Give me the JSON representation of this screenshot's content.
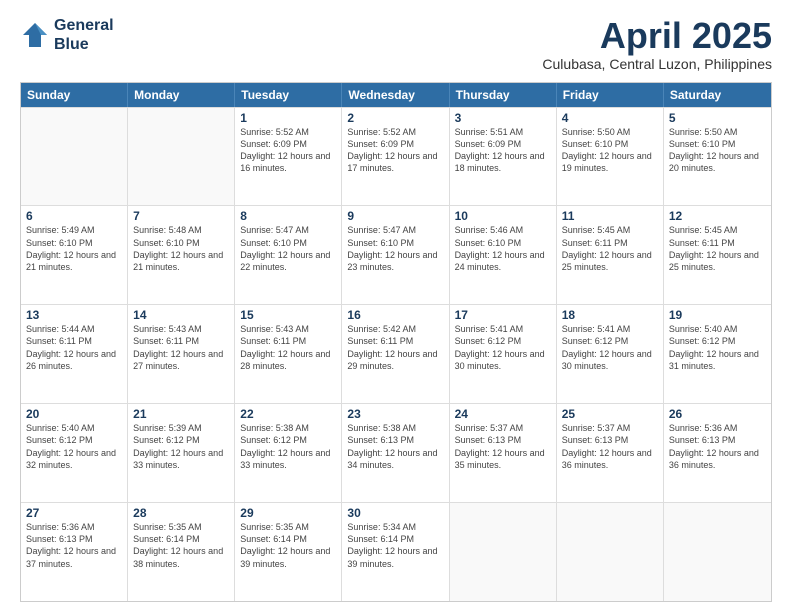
{
  "logo": {
    "line1": "General",
    "line2": "Blue"
  },
  "title": "April 2025",
  "subtitle": "Culubasa, Central Luzon, Philippines",
  "header_days": [
    "Sunday",
    "Monday",
    "Tuesday",
    "Wednesday",
    "Thursday",
    "Friday",
    "Saturday"
  ],
  "weeks": [
    [
      {
        "day": "",
        "info": ""
      },
      {
        "day": "",
        "info": ""
      },
      {
        "day": "1",
        "info": "Sunrise: 5:52 AM\nSunset: 6:09 PM\nDaylight: 12 hours\nand 16 minutes."
      },
      {
        "day": "2",
        "info": "Sunrise: 5:52 AM\nSunset: 6:09 PM\nDaylight: 12 hours\nand 17 minutes."
      },
      {
        "day": "3",
        "info": "Sunrise: 5:51 AM\nSunset: 6:09 PM\nDaylight: 12 hours\nand 18 minutes."
      },
      {
        "day": "4",
        "info": "Sunrise: 5:50 AM\nSunset: 6:10 PM\nDaylight: 12 hours\nand 19 minutes."
      },
      {
        "day": "5",
        "info": "Sunrise: 5:50 AM\nSunset: 6:10 PM\nDaylight: 12 hours\nand 20 minutes."
      }
    ],
    [
      {
        "day": "6",
        "info": "Sunrise: 5:49 AM\nSunset: 6:10 PM\nDaylight: 12 hours\nand 21 minutes."
      },
      {
        "day": "7",
        "info": "Sunrise: 5:48 AM\nSunset: 6:10 PM\nDaylight: 12 hours\nand 21 minutes."
      },
      {
        "day": "8",
        "info": "Sunrise: 5:47 AM\nSunset: 6:10 PM\nDaylight: 12 hours\nand 22 minutes."
      },
      {
        "day": "9",
        "info": "Sunrise: 5:47 AM\nSunset: 6:10 PM\nDaylight: 12 hours\nand 23 minutes."
      },
      {
        "day": "10",
        "info": "Sunrise: 5:46 AM\nSunset: 6:10 PM\nDaylight: 12 hours\nand 24 minutes."
      },
      {
        "day": "11",
        "info": "Sunrise: 5:45 AM\nSunset: 6:11 PM\nDaylight: 12 hours\nand 25 minutes."
      },
      {
        "day": "12",
        "info": "Sunrise: 5:45 AM\nSunset: 6:11 PM\nDaylight: 12 hours\nand 25 minutes."
      }
    ],
    [
      {
        "day": "13",
        "info": "Sunrise: 5:44 AM\nSunset: 6:11 PM\nDaylight: 12 hours\nand 26 minutes."
      },
      {
        "day": "14",
        "info": "Sunrise: 5:43 AM\nSunset: 6:11 PM\nDaylight: 12 hours\nand 27 minutes."
      },
      {
        "day": "15",
        "info": "Sunrise: 5:43 AM\nSunset: 6:11 PM\nDaylight: 12 hours\nand 28 minutes."
      },
      {
        "day": "16",
        "info": "Sunrise: 5:42 AM\nSunset: 6:11 PM\nDaylight: 12 hours\nand 29 minutes."
      },
      {
        "day": "17",
        "info": "Sunrise: 5:41 AM\nSunset: 6:12 PM\nDaylight: 12 hours\nand 30 minutes."
      },
      {
        "day": "18",
        "info": "Sunrise: 5:41 AM\nSunset: 6:12 PM\nDaylight: 12 hours\nand 30 minutes."
      },
      {
        "day": "19",
        "info": "Sunrise: 5:40 AM\nSunset: 6:12 PM\nDaylight: 12 hours\nand 31 minutes."
      }
    ],
    [
      {
        "day": "20",
        "info": "Sunrise: 5:40 AM\nSunset: 6:12 PM\nDaylight: 12 hours\nand 32 minutes."
      },
      {
        "day": "21",
        "info": "Sunrise: 5:39 AM\nSunset: 6:12 PM\nDaylight: 12 hours\nand 33 minutes."
      },
      {
        "day": "22",
        "info": "Sunrise: 5:38 AM\nSunset: 6:12 PM\nDaylight: 12 hours\nand 33 minutes."
      },
      {
        "day": "23",
        "info": "Sunrise: 5:38 AM\nSunset: 6:13 PM\nDaylight: 12 hours\nand 34 minutes."
      },
      {
        "day": "24",
        "info": "Sunrise: 5:37 AM\nSunset: 6:13 PM\nDaylight: 12 hours\nand 35 minutes."
      },
      {
        "day": "25",
        "info": "Sunrise: 5:37 AM\nSunset: 6:13 PM\nDaylight: 12 hours\nand 36 minutes."
      },
      {
        "day": "26",
        "info": "Sunrise: 5:36 AM\nSunset: 6:13 PM\nDaylight: 12 hours\nand 36 minutes."
      }
    ],
    [
      {
        "day": "27",
        "info": "Sunrise: 5:36 AM\nSunset: 6:13 PM\nDaylight: 12 hours\nand 37 minutes."
      },
      {
        "day": "28",
        "info": "Sunrise: 5:35 AM\nSunset: 6:14 PM\nDaylight: 12 hours\nand 38 minutes."
      },
      {
        "day": "29",
        "info": "Sunrise: 5:35 AM\nSunset: 6:14 PM\nDaylight: 12 hours\nand 39 minutes."
      },
      {
        "day": "30",
        "info": "Sunrise: 5:34 AM\nSunset: 6:14 PM\nDaylight: 12 hours\nand 39 minutes."
      },
      {
        "day": "",
        "info": ""
      },
      {
        "day": "",
        "info": ""
      },
      {
        "day": "",
        "info": ""
      }
    ]
  ]
}
